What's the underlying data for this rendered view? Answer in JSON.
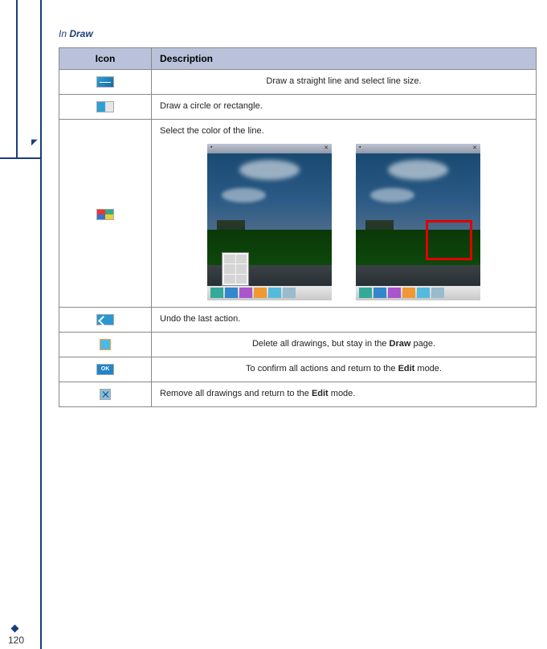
{
  "page_number": "120",
  "section": {
    "prefix": "In ",
    "title": "Draw"
  },
  "headers": {
    "icon": "Icon",
    "description": "Description"
  },
  "rows": {
    "line": "Draw a straight line and select line size.",
    "shape": "Draw a circle or rectangle.",
    "color": "Select the color of the line.",
    "undo": "Undo the last action.",
    "delete_pre": "Delete all drawings, but stay in the ",
    "delete_bold": "Draw",
    "delete_post": " page.",
    "confirm_pre": "To confirm all actions and return to the ",
    "confirm_bold": "Edit",
    "confirm_post": " mode.",
    "remove_pre": "Remove all drawings and return to the ",
    "remove_bold": "Edit",
    "remove_post": " mode."
  }
}
